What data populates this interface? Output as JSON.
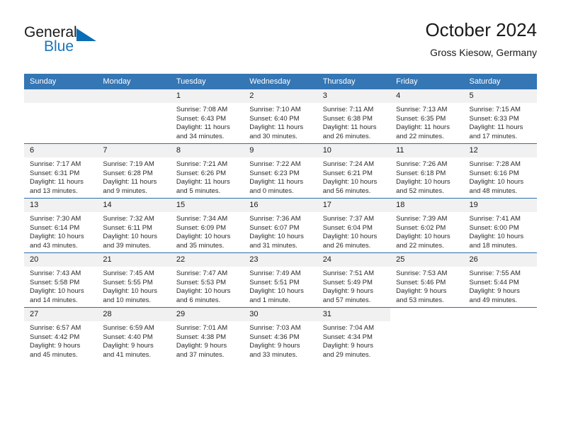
{
  "brand": {
    "word1": "General",
    "word2": "Blue",
    "accent_color": "#0b6db5"
  },
  "header": {
    "month_title": "October 2024",
    "location": "Gross Kiesow, Germany"
  },
  "calendar": {
    "header_color": "#3576b4",
    "weekday_headers": [
      "Sunday",
      "Monday",
      "Tuesday",
      "Wednesday",
      "Thursday",
      "Friday",
      "Saturday"
    ],
    "weeks": [
      [
        {
          "day": "",
          "empty": true
        },
        {
          "day": "",
          "empty": true
        },
        {
          "day": "1",
          "sunrise": "Sunrise: 7:08 AM",
          "sunset": "Sunset: 6:43 PM",
          "daylight": "Daylight: 11 hours and 34 minutes."
        },
        {
          "day": "2",
          "sunrise": "Sunrise: 7:10 AM",
          "sunset": "Sunset: 6:40 PM",
          "daylight": "Daylight: 11 hours and 30 minutes."
        },
        {
          "day": "3",
          "sunrise": "Sunrise: 7:11 AM",
          "sunset": "Sunset: 6:38 PM",
          "daylight": "Daylight: 11 hours and 26 minutes."
        },
        {
          "day": "4",
          "sunrise": "Sunrise: 7:13 AM",
          "sunset": "Sunset: 6:35 PM",
          "daylight": "Daylight: 11 hours and 22 minutes."
        },
        {
          "day": "5",
          "sunrise": "Sunrise: 7:15 AM",
          "sunset": "Sunset: 6:33 PM",
          "daylight": "Daylight: 11 hours and 17 minutes."
        }
      ],
      [
        {
          "day": "6",
          "sunrise": "Sunrise: 7:17 AM",
          "sunset": "Sunset: 6:31 PM",
          "daylight": "Daylight: 11 hours and 13 minutes."
        },
        {
          "day": "7",
          "sunrise": "Sunrise: 7:19 AM",
          "sunset": "Sunset: 6:28 PM",
          "daylight": "Daylight: 11 hours and 9 minutes."
        },
        {
          "day": "8",
          "sunrise": "Sunrise: 7:21 AM",
          "sunset": "Sunset: 6:26 PM",
          "daylight": "Daylight: 11 hours and 5 minutes."
        },
        {
          "day": "9",
          "sunrise": "Sunrise: 7:22 AM",
          "sunset": "Sunset: 6:23 PM",
          "daylight": "Daylight: 11 hours and 0 minutes."
        },
        {
          "day": "10",
          "sunrise": "Sunrise: 7:24 AM",
          "sunset": "Sunset: 6:21 PM",
          "daylight": "Daylight: 10 hours and 56 minutes."
        },
        {
          "day": "11",
          "sunrise": "Sunrise: 7:26 AM",
          "sunset": "Sunset: 6:18 PM",
          "daylight": "Daylight: 10 hours and 52 minutes."
        },
        {
          "day": "12",
          "sunrise": "Sunrise: 7:28 AM",
          "sunset": "Sunset: 6:16 PM",
          "daylight": "Daylight: 10 hours and 48 minutes."
        }
      ],
      [
        {
          "day": "13",
          "sunrise": "Sunrise: 7:30 AM",
          "sunset": "Sunset: 6:14 PM",
          "daylight": "Daylight: 10 hours and 43 minutes."
        },
        {
          "day": "14",
          "sunrise": "Sunrise: 7:32 AM",
          "sunset": "Sunset: 6:11 PM",
          "daylight": "Daylight: 10 hours and 39 minutes."
        },
        {
          "day": "15",
          "sunrise": "Sunrise: 7:34 AM",
          "sunset": "Sunset: 6:09 PM",
          "daylight": "Daylight: 10 hours and 35 minutes."
        },
        {
          "day": "16",
          "sunrise": "Sunrise: 7:36 AM",
          "sunset": "Sunset: 6:07 PM",
          "daylight": "Daylight: 10 hours and 31 minutes."
        },
        {
          "day": "17",
          "sunrise": "Sunrise: 7:37 AM",
          "sunset": "Sunset: 6:04 PM",
          "daylight": "Daylight: 10 hours and 26 minutes."
        },
        {
          "day": "18",
          "sunrise": "Sunrise: 7:39 AM",
          "sunset": "Sunset: 6:02 PM",
          "daylight": "Daylight: 10 hours and 22 minutes."
        },
        {
          "day": "19",
          "sunrise": "Sunrise: 7:41 AM",
          "sunset": "Sunset: 6:00 PM",
          "daylight": "Daylight: 10 hours and 18 minutes."
        }
      ],
      [
        {
          "day": "20",
          "sunrise": "Sunrise: 7:43 AM",
          "sunset": "Sunset: 5:58 PM",
          "daylight": "Daylight: 10 hours and 14 minutes."
        },
        {
          "day": "21",
          "sunrise": "Sunrise: 7:45 AM",
          "sunset": "Sunset: 5:55 PM",
          "daylight": "Daylight: 10 hours and 10 minutes."
        },
        {
          "day": "22",
          "sunrise": "Sunrise: 7:47 AM",
          "sunset": "Sunset: 5:53 PM",
          "daylight": "Daylight: 10 hours and 6 minutes."
        },
        {
          "day": "23",
          "sunrise": "Sunrise: 7:49 AM",
          "sunset": "Sunset: 5:51 PM",
          "daylight": "Daylight: 10 hours and 1 minute."
        },
        {
          "day": "24",
          "sunrise": "Sunrise: 7:51 AM",
          "sunset": "Sunset: 5:49 PM",
          "daylight": "Daylight: 9 hours and 57 minutes."
        },
        {
          "day": "25",
          "sunrise": "Sunrise: 7:53 AM",
          "sunset": "Sunset: 5:46 PM",
          "daylight": "Daylight: 9 hours and 53 minutes."
        },
        {
          "day": "26",
          "sunrise": "Sunrise: 7:55 AM",
          "sunset": "Sunset: 5:44 PM",
          "daylight": "Daylight: 9 hours and 49 minutes."
        }
      ],
      [
        {
          "day": "27",
          "sunrise": "Sunrise: 6:57 AM",
          "sunset": "Sunset: 4:42 PM",
          "daylight": "Daylight: 9 hours and 45 minutes."
        },
        {
          "day": "28",
          "sunrise": "Sunrise: 6:59 AM",
          "sunset": "Sunset: 4:40 PM",
          "daylight": "Daylight: 9 hours and 41 minutes."
        },
        {
          "day": "29",
          "sunrise": "Sunrise: 7:01 AM",
          "sunset": "Sunset: 4:38 PM",
          "daylight": "Daylight: 9 hours and 37 minutes."
        },
        {
          "day": "30",
          "sunrise": "Sunrise: 7:03 AM",
          "sunset": "Sunset: 4:36 PM",
          "daylight": "Daylight: 9 hours and 33 minutes."
        },
        {
          "day": "31",
          "sunrise": "Sunrise: 7:04 AM",
          "sunset": "Sunset: 4:34 PM",
          "daylight": "Daylight: 9 hours and 29 minutes."
        },
        {
          "day": "",
          "empty": true,
          "blank": true
        },
        {
          "day": "",
          "empty": true,
          "blank": true
        }
      ]
    ]
  }
}
